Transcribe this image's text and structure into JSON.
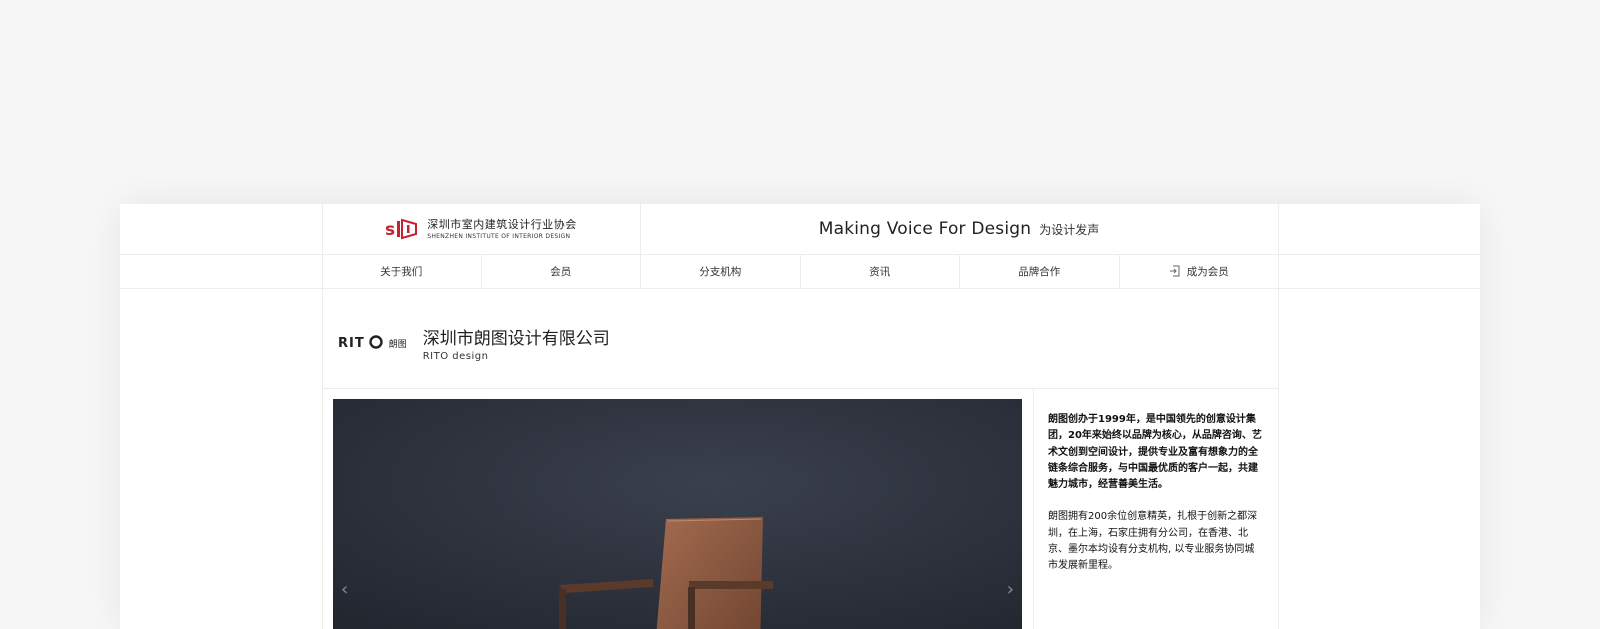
{
  "header": {
    "logo": {
      "name_cn": "深圳市室内建筑设计行业协会",
      "name_en": "SHENZHEN INSTITUTE OF INTERIOR DESIGN",
      "brand_color": "#c8202d"
    },
    "slogan_en": "Making Voice For Design",
    "slogan_cn": "为设计发声"
  },
  "nav": {
    "items": [
      {
        "label": "关于我们"
      },
      {
        "label": "会员"
      },
      {
        "label": "分支机构"
      },
      {
        "label": "资讯"
      },
      {
        "label": "品牌合作"
      },
      {
        "label": "成为会员",
        "icon": "login-icon"
      }
    ]
  },
  "company": {
    "logo_text": "RIT",
    "logo_cn": "朗图",
    "name_cn": "深圳市朗图设计有限公司",
    "name_en": "RITO design"
  },
  "gallery": {
    "prev_icon": "chevron-left-icon",
    "next_icon": "chevron-right-icon"
  },
  "description": {
    "para1": "朗图创办于1999年，是中国领先的创意设计集团，20年来始终以品牌为核心，从品牌咨询、艺术文创到空间设计，提供专业及富有想象力的全链条综合服务，与中国最优质的客户一起，共建魅力城市，经营善美生活。",
    "para2": "朗图拥有200余位创意精英，扎根于创新之都深圳，在上海，石家庄拥有分公司，在香港、北京、墨尔本均设有分支机构, 以专业服务协同城市发展新里程。"
  }
}
